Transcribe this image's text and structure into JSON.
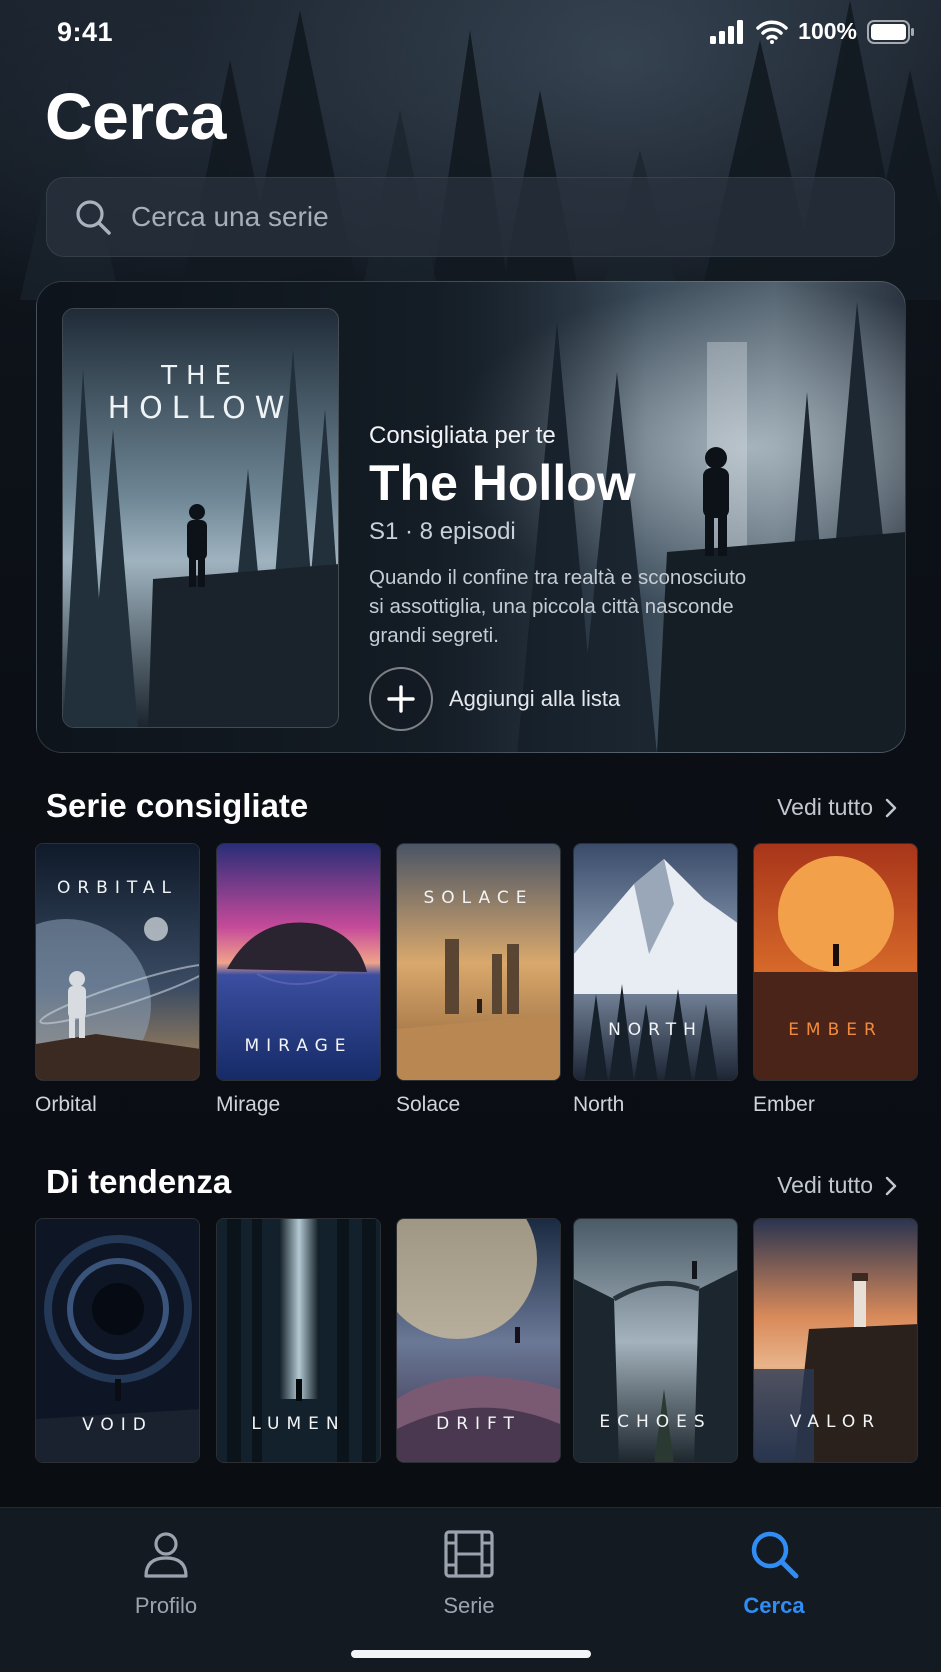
{
  "status_bar": {
    "time": "9:41",
    "battery": "100%"
  },
  "page_title": "Cerca",
  "search": {
    "placeholder": "Cerca una serie",
    "icon": "search-icon"
  },
  "featured": {
    "kicker": "Consigliata per te",
    "title": "The Hollow",
    "meta": "S1 · 8 episodi",
    "description": "Quando il confine tra realtà e sconosciuto si assottiglia, una piccola città nasconde grandi segreti.",
    "poster_line1": "THE",
    "poster_line2": "HOLLOW",
    "add_label": "Aggiungi alla lista"
  },
  "recommended": {
    "title": "Serie consigliate",
    "see_all": "Vedi tutto",
    "items": [
      {
        "name": "Orbital",
        "poster_text": "ORBITAL"
      },
      {
        "name": "Mirage",
        "poster_text": "MIRAGE"
      },
      {
        "name": "Solace",
        "poster_text": "SOLACE"
      },
      {
        "name": "North",
        "poster_text": "NORTH"
      },
      {
        "name": "Ember",
        "poster_text": "EMBER"
      }
    ]
  },
  "trending": {
    "title": "Di tendenza",
    "see_all": "Vedi tutto",
    "items": [
      {
        "poster_text": "VOID"
      },
      {
        "poster_text": "LUMEN"
      },
      {
        "poster_text": "DRIFT"
      },
      {
        "poster_text": "ECHOES"
      },
      {
        "poster_text": "VALOR"
      }
    ]
  },
  "tabs": [
    {
      "label": "Profilo",
      "icon": "person-icon",
      "active": false
    },
    {
      "label": "Serie",
      "icon": "film-icon",
      "active": false
    },
    {
      "label": "Cerca",
      "icon": "search-icon",
      "active": true
    }
  ],
  "colors": {
    "accent": "#2f8df5",
    "background": "#0b0f15",
    "ember_text": "#f08a3c"
  }
}
